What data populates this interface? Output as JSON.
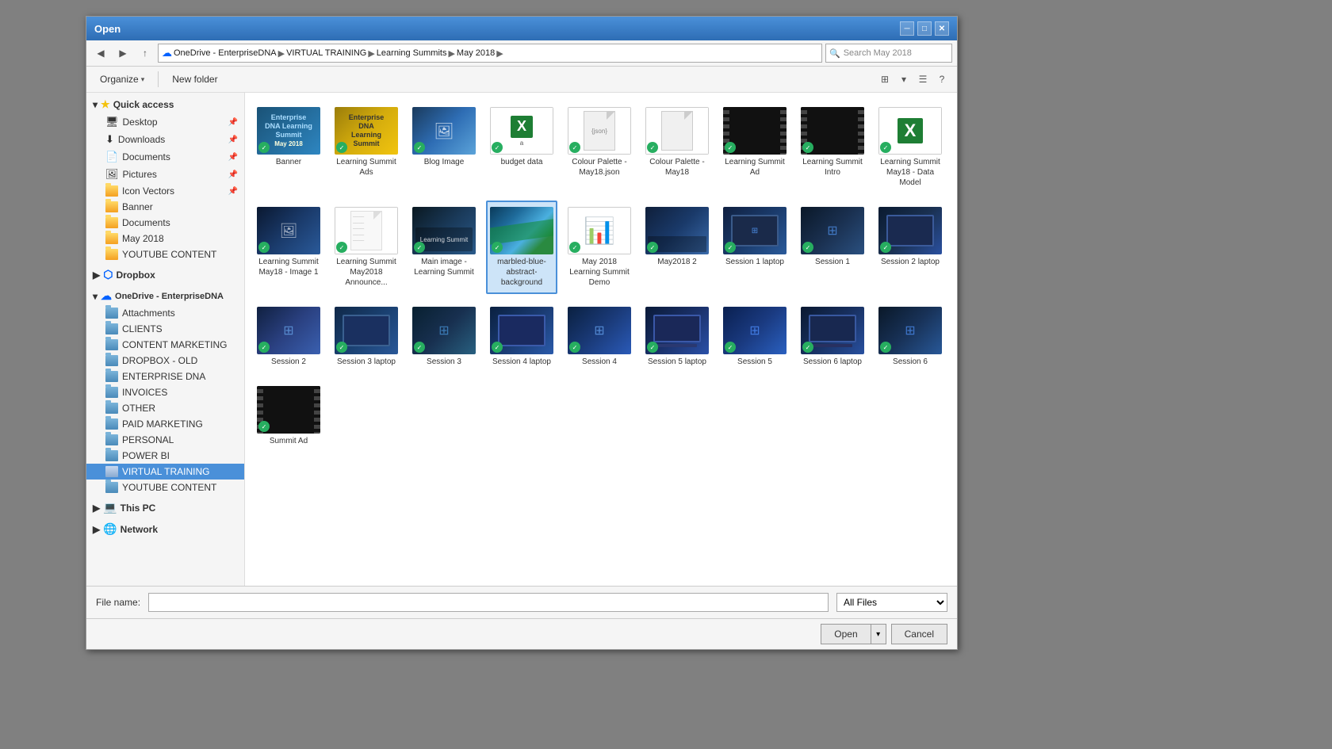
{
  "dialog": {
    "title": "Open",
    "close_btn": "✕",
    "minimize_btn": "─",
    "maximize_btn": "□"
  },
  "nav": {
    "back_tooltip": "Back",
    "forward_tooltip": "Forward",
    "up_tooltip": "Up",
    "address_segments": [
      "OneDrive - EnterpriseDNA",
      "VIRTUAL TRAINING",
      "Learning Summits",
      "May 2018"
    ],
    "search_placeholder": "Search May 2018"
  },
  "toolbar": {
    "organize_label": "Organize",
    "new_folder_label": "New folder"
  },
  "left_panel": {
    "quick_access": {
      "label": "Quick access",
      "items": [
        {
          "name": "Desktop",
          "type": "special"
        },
        {
          "name": "Downloads",
          "type": "special"
        },
        {
          "name": "Documents",
          "type": "special"
        },
        {
          "name": "Pictures",
          "type": "special"
        },
        {
          "name": "Icon Vectors",
          "type": "special"
        },
        {
          "name": "Banner",
          "type": "folder_yellow"
        },
        {
          "name": "Documents",
          "type": "folder_yellow"
        },
        {
          "name": "May 2018",
          "type": "folder_yellow"
        },
        {
          "name": "YOUTUBE CONTENT",
          "type": "folder_yellow"
        }
      ]
    },
    "dropbox": {
      "label": "Dropbox",
      "type": "dropbox"
    },
    "onedrive": {
      "label": "OneDrive - EnterpriseDNA",
      "type": "onedrive",
      "items": [
        {
          "name": "Attachments",
          "type": "folder_yellow"
        },
        {
          "name": "CLIENTS",
          "type": "folder_yellow"
        },
        {
          "name": "CONTENT MARKETING",
          "type": "folder_yellow"
        },
        {
          "name": "DROPBOX - OLD",
          "type": "folder_yellow"
        },
        {
          "name": "ENTERPRISE DNA",
          "type": "folder_yellow"
        },
        {
          "name": "INVOICES",
          "type": "folder_yellow"
        },
        {
          "name": "OTHER",
          "type": "folder_yellow"
        },
        {
          "name": "PAID MARKETING",
          "type": "folder_yellow"
        },
        {
          "name": "PERSONAL",
          "type": "folder_yellow"
        },
        {
          "name": "POWER BI",
          "type": "folder_yellow"
        },
        {
          "name": "VIRTUAL TRAINING",
          "type": "folder_yellow_selected"
        },
        {
          "name": "YOUTUBE CONTENT",
          "type": "folder_yellow"
        }
      ]
    },
    "this_pc": {
      "label": "This PC",
      "type": "pc"
    },
    "network": {
      "label": "Network",
      "type": "network"
    }
  },
  "files": [
    {
      "name": "Banner",
      "type": "blue_book",
      "synced": true
    },
    {
      "name": "Learning Summit Ads",
      "type": "gold_book",
      "synced": true
    },
    {
      "name": "Blog Image",
      "type": "image_blue",
      "synced": true
    },
    {
      "name": "budget data",
      "type": "excel",
      "synced": true
    },
    {
      "name": "Colour Palette - May18.json",
      "type": "doc",
      "synced": true
    },
    {
      "name": "Colour Palette - May18",
      "type": "doc",
      "synced": true
    },
    {
      "name": "Learning Summit Ad",
      "type": "video_red",
      "synced": true
    },
    {
      "name": "Learning Summit Intro",
      "type": "video_dark_red",
      "synced": true
    },
    {
      "name": "Learning Summit May18 - Data Model",
      "type": "excel2",
      "synced": true
    },
    {
      "name": "Learning Summit May18 - Image 1",
      "type": "screenshot_blue",
      "synced": true
    },
    {
      "name": "Learning Summit May2018 Announce...",
      "type": "doc_blank",
      "synced": true
    },
    {
      "name": "Main image - Learning Summit",
      "type": "screenshot_dark",
      "synced": true
    },
    {
      "name": "marbled-blue-abstract-background",
      "type": "green_wavy",
      "synced": true,
      "selected": true
    },
    {
      "name": "May 2018 Learning Summit Demo",
      "type": "chart_yellow",
      "synced": true
    },
    {
      "name": "May2018 2",
      "type": "screenshot_2",
      "synced": true
    },
    {
      "name": "Session 1 laptop",
      "type": "laptop_1",
      "synced": true
    },
    {
      "name": "Session 1",
      "type": "session_1",
      "synced": true
    },
    {
      "name": "Session 2 laptop",
      "type": "laptop_2",
      "synced": true
    },
    {
      "name": "Session 2",
      "type": "session_2",
      "synced": true
    },
    {
      "name": "Session 3 laptop",
      "type": "laptop_3",
      "synced": true
    },
    {
      "name": "Session 3",
      "type": "session_3",
      "synced": true
    },
    {
      "name": "Session 4 laptop",
      "type": "laptop_4",
      "synced": true
    },
    {
      "name": "Session 4",
      "type": "session_4",
      "synced": true
    },
    {
      "name": "Session 5 laptop",
      "type": "laptop_5",
      "synced": true
    },
    {
      "name": "Session 5",
      "type": "session_5",
      "synced": true
    },
    {
      "name": "Session 6 laptop",
      "type": "laptop_6",
      "synced": true
    },
    {
      "name": "Session 6",
      "type": "session_6",
      "synced": true
    },
    {
      "name": "Summit Ad",
      "type": "green_film",
      "synced": true
    }
  ],
  "bottom": {
    "file_name_label": "File name:",
    "file_name_value": "",
    "file_type_label": "All Files",
    "open_btn": "Open",
    "cancel_btn": "Cancel"
  }
}
